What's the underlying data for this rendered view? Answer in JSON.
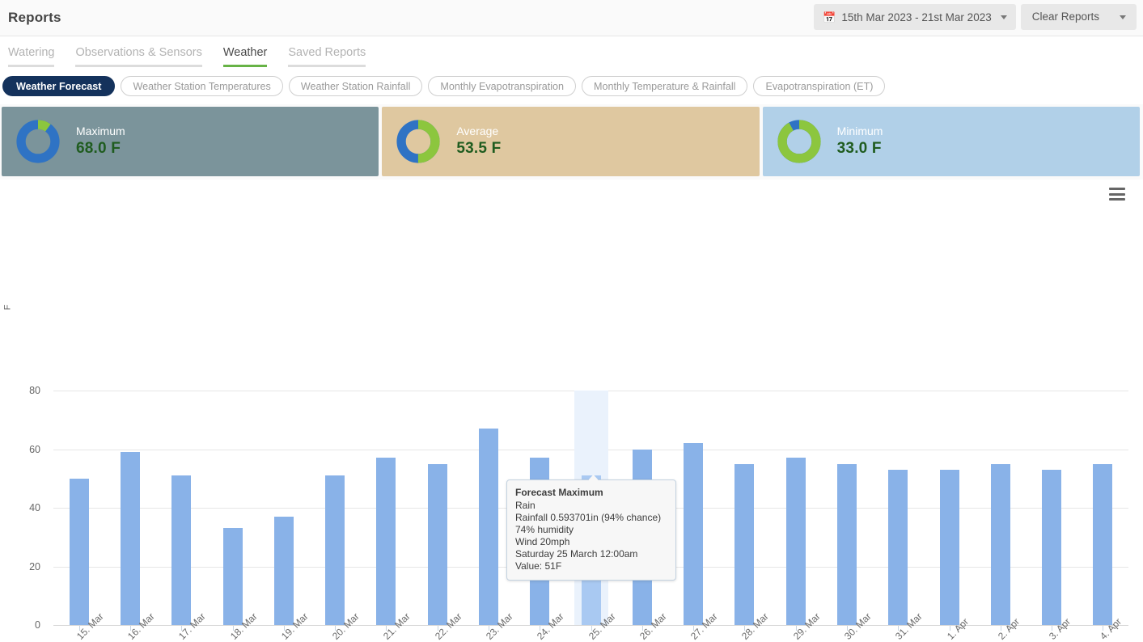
{
  "header": {
    "title": "Reports",
    "date_range": "15th Mar 2023 - 21st Mar 2023",
    "calendar_icon": "calendar-icon",
    "clear_reports_label": "Clear Reports"
  },
  "subnav": {
    "items": [
      {
        "label": "Watering",
        "active": false
      },
      {
        "label": "Observations & Sensors",
        "active": false
      },
      {
        "label": "Weather",
        "active": true
      },
      {
        "label": "Saved Reports",
        "active": false
      }
    ]
  },
  "report_tabs": {
    "items": [
      {
        "label": "Weather Forecast",
        "active": true
      },
      {
        "label": "Weather Station Temperatures",
        "active": false
      },
      {
        "label": "Weather Station Rainfall",
        "active": false
      },
      {
        "label": "Monthly Evapotranspiration",
        "active": false
      },
      {
        "label": "Monthly Temperature & Rainfall",
        "active": false
      },
      {
        "label": "Evapotranspiration (ET)",
        "active": false
      }
    ]
  },
  "stat_cards": [
    {
      "label": "Maximum",
      "value": "68.0 F",
      "bg": "#7b949b",
      "blue_pct": 90,
      "green_pct": 10
    },
    {
      "label": "Average",
      "value": "53.5 F",
      "bg": "#dfc8a0",
      "blue_pct": 50,
      "green_pct": 50
    },
    {
      "label": "Minimum",
      "value": "33.0 F",
      "bg": "#b1d0e8",
      "blue_pct": 8,
      "green_pct": 92
    }
  ],
  "colors": {
    "bar": "#89b2e8",
    "bar_hovered": "#a9c9f2",
    "donut_blue": "#2f73c4",
    "donut_green": "#8cc63e",
    "value_green": "#1f5c1f",
    "active_pill": "#14325c",
    "active_tab_underline": "#67b346"
  },
  "chart_data": {
    "type": "bar",
    "title": "",
    "xlabel": "",
    "ylabel": "F",
    "ylim": [
      0,
      80
    ],
    "yticks": [
      0,
      20,
      40,
      60,
      80
    ],
    "grid": true,
    "legend_position": "bottom",
    "categories": [
      "15. Mar",
      "16. Mar",
      "17. Mar",
      "18. Mar",
      "19. Mar",
      "20. Mar",
      "21. Mar",
      "22. Mar",
      "23. Mar",
      "24. Mar",
      "25. Mar",
      "26. Mar",
      "27. Mar",
      "28. Mar",
      "29. Mar",
      "30. Mar",
      "31. Mar",
      "1. Apr",
      "2. Apr",
      "3. Apr",
      "4. Apr"
    ],
    "series": [
      {
        "name": "Forecast Maximum",
        "color": "#89b2e8",
        "values": [
          50,
          59,
          51,
          33,
          37,
          51,
          57,
          55,
          67,
          57,
          51,
          60,
          62,
          55,
          57,
          55,
          53,
          53,
          55,
          53,
          55
        ]
      }
    ],
    "hovered_index": 10,
    "menu_icon": "hamburger-menu-icon"
  },
  "tooltip": {
    "title": "Forecast Maximum",
    "lines": [
      "Rain",
      "Rainfall 0.593701in (94% chance)",
      "74% humidity",
      "Wind 20mph",
      "Saturday 25 March 12:00am",
      "Value: 51F"
    ]
  },
  "legend": {
    "label": "Forecast Maximum"
  }
}
